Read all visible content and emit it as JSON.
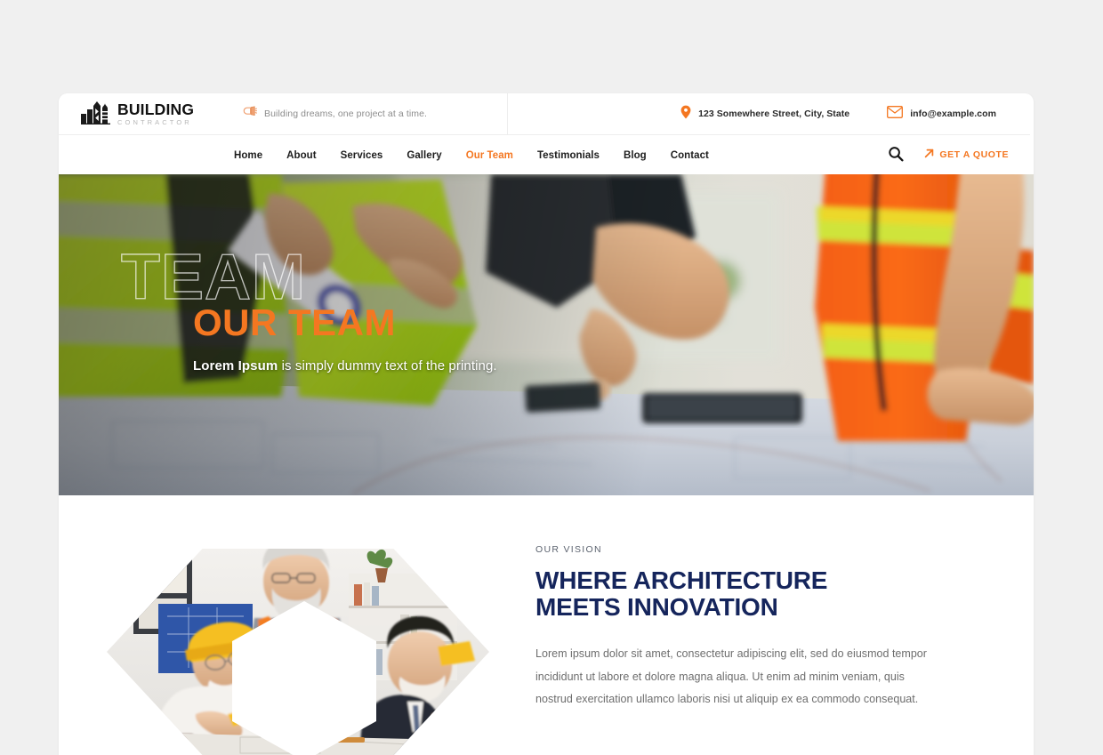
{
  "brand": {
    "icon": "building-skyline-icon",
    "title": "BUILDING",
    "subtitle": "CONTRACTOR"
  },
  "topbar": {
    "tagline_icon": "megaphone-icon",
    "tagline": "Building dreams, one project at a time.",
    "address_icon": "location-pin-icon",
    "address": "123 Somewhere Street, City, State",
    "email_icon": "envelope-icon",
    "email": "info@example.com"
  },
  "nav": {
    "items": [
      {
        "label": "Home",
        "active": false
      },
      {
        "label": "About",
        "active": false
      },
      {
        "label": "Services",
        "active": false
      },
      {
        "label": "Gallery",
        "active": false
      },
      {
        "label": "Our Team",
        "active": true
      },
      {
        "label": "Testimonials",
        "active": false
      },
      {
        "label": "Blog",
        "active": false
      },
      {
        "label": "Contact",
        "active": false
      }
    ],
    "search_icon": "search-icon",
    "quote_icon": "arrow-up-right-icon",
    "quote_label": "GET A QUOTE"
  },
  "hero": {
    "watermark": "TEAM",
    "title": "OUR TEAM",
    "subtitle_bold": "Lorem Ipsum",
    "subtitle_rest": " is simply dummy text of the printing.",
    "image_alt": "construction-workers-reviewing-blueprints"
  },
  "vision": {
    "image_alt": "team-collage-hexagon",
    "eyebrow": "OUR VISION",
    "title": "WHERE ARCHITECTURE MEETS INNOVATION",
    "body": "Lorem ipsum dolor sit amet, consectetur adipiscing elit, sed do eiusmod tempor incididunt ut labore et dolore magna aliqua. Ut enim ad minim veniam, quis nostrud exercitation ullamco laboris nisi ut aliquip ex ea commodo consequat."
  },
  "colors": {
    "accent": "#f47721",
    "heading_navy": "#15255c",
    "page_bg": "#f0f0f0",
    "nav_text": "#1d1d1d",
    "body_text": "#6d6d6d"
  }
}
